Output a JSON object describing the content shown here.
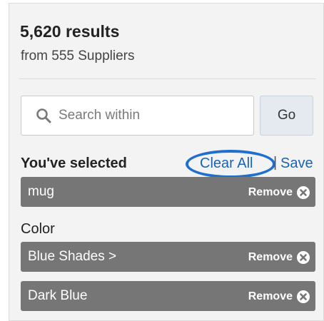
{
  "summary": {
    "results": "5,620 results",
    "suppliers": "from 555 Suppliers"
  },
  "search": {
    "placeholder": "Search within",
    "value": "",
    "go_label": "Go"
  },
  "selection": {
    "heading": "You've selected",
    "clear_all": "Clear All",
    "separator": "|",
    "save": "Save",
    "keyword_chip": {
      "label": "mug",
      "remove": "Remove"
    }
  },
  "color_filter": {
    "heading": "Color",
    "chips": [
      {
        "label": "Blue Shades >",
        "remove": "Remove"
      },
      {
        "label": "Dark Blue",
        "remove": "Remove"
      }
    ]
  },
  "colors": {
    "chip_bg": "#767676",
    "link": "#1a63b5",
    "highlight_ring": "#1f6fd0",
    "panel_bg": "#f3f3f3"
  },
  "icons": {
    "search": "search-icon",
    "remove": "close-circle-icon"
  }
}
